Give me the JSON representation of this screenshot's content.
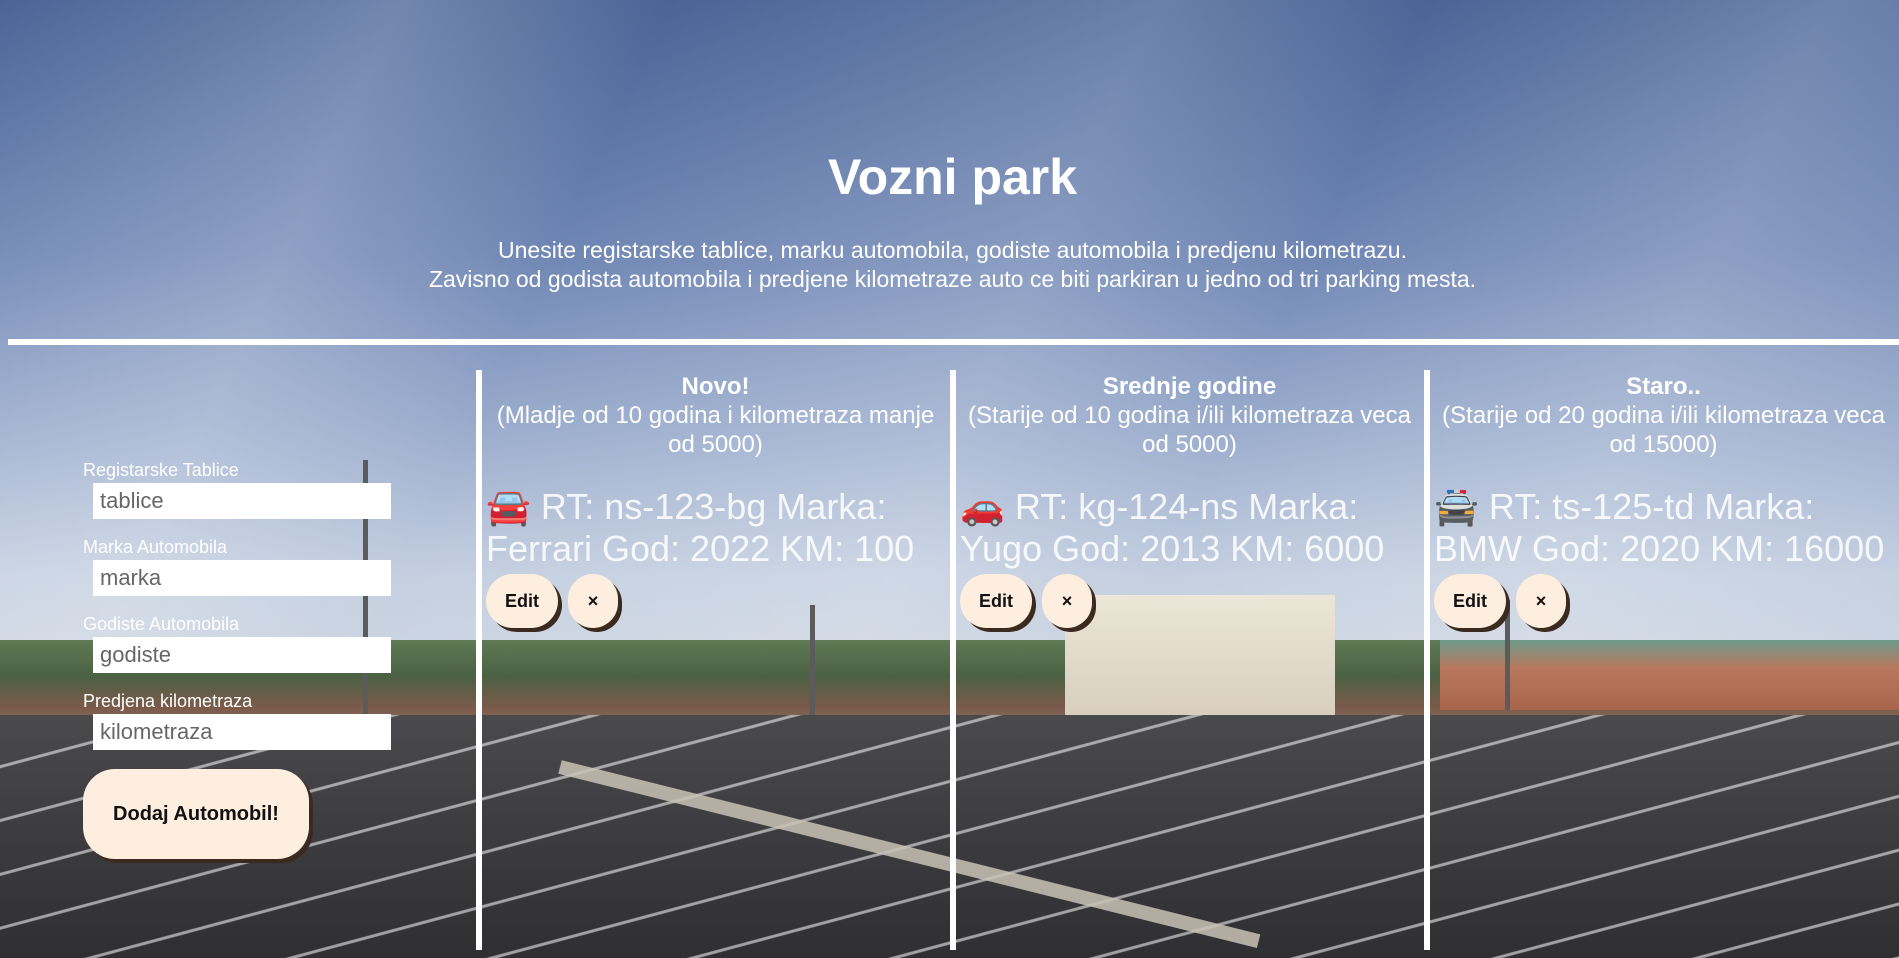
{
  "header": {
    "title": "Vozni park",
    "line1": "Unesite registarske tablice, marku automobila, godiste automobila i predjenu kilometrazu.",
    "line2": "Zavisno od godista automobila i predjene kilometraze auto ce biti parkiran u jedno od tri parking mesta."
  },
  "form": {
    "plates_label": "Registarske Tablice",
    "plates_placeholder": "tablice",
    "brand_label": "Marka Automobila",
    "brand_placeholder": "marka",
    "year_label": "Godiste Automobila",
    "year_placeholder": "godiste",
    "km_label": "Predjena kilometraza",
    "km_placeholder": "kilometraza",
    "submit_label": "Dodaj Automobil!"
  },
  "columns": [
    {
      "heading": "Novo!",
      "description": "(Mladje od 10 godina i kilometraza manje od 5000)",
      "cars": [
        {
          "icon": "🚘",
          "icon_name": "car-front-icon",
          "text": "RT: ns-123-bg Marka: Ferrari God: 2022 KM: 100",
          "edit_label": "Edit",
          "delete_label": "×"
        }
      ]
    },
    {
      "heading": "Srednje godine",
      "description": "(Starije od 10 godina i/ili kilometraza veca od 5000)",
      "cars": [
        {
          "icon": "🚗",
          "icon_name": "car-icon",
          "text": "RT: kg-124-ns Marka: Yugo God: 2013 KM: 6000",
          "edit_label": "Edit",
          "delete_label": "×"
        }
      ]
    },
    {
      "heading": "Staro..",
      "description": "(Starije od 20 godina i/ili kilometraza veca od 15000)",
      "cars": [
        {
          "icon": "🚔",
          "icon_name": "police-car-icon",
          "text": "RT: ts-125-td Marka: BMW God: 2020 KM: 16000",
          "edit_label": "Edit",
          "delete_label": "×"
        }
      ]
    }
  ],
  "colors": {
    "button_bg": "#fdeee0",
    "button_shadow": "#3a2a20",
    "text": "#ffffff"
  }
}
